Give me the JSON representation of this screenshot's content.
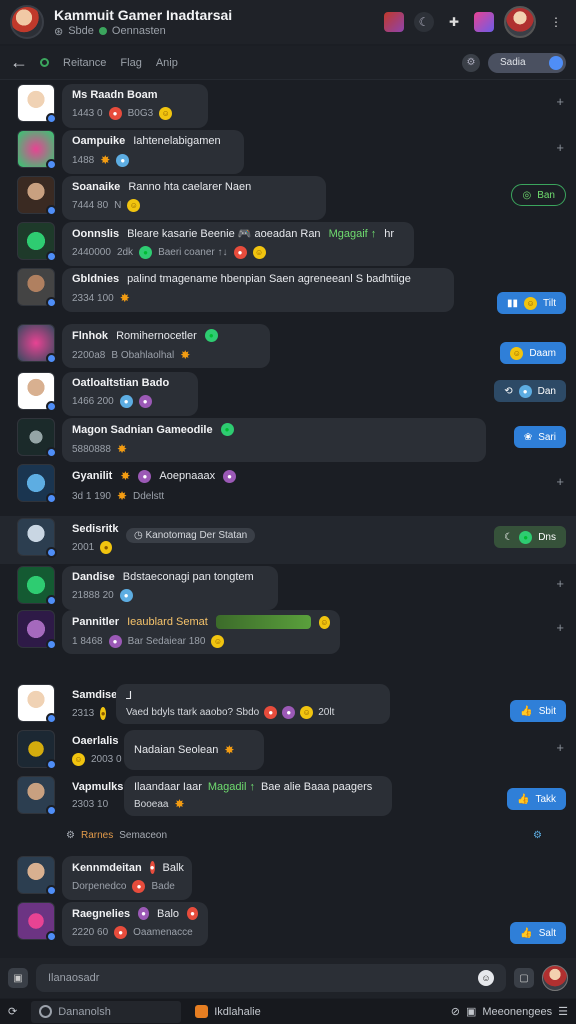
{
  "header": {
    "title": "Kammuit Gamer Inadtarsai",
    "subtitle": "Sbde",
    "status": "Oennasten"
  },
  "nav": {
    "back": "←",
    "tabs": [
      "Reitance",
      "Flag",
      "Anip"
    ],
    "toggle_label": "Sadia"
  },
  "messages": [
    {
      "name": "Ms Raadn Boam",
      "time": "1443 0",
      "meta": "B0G3",
      "react": ""
    },
    {
      "name": "Oampuike",
      "text": "Iahtenelabigamen",
      "time": "1488",
      "react": ""
    },
    {
      "name": "Soanaike",
      "text": "Ranno hta caelarer Naen",
      "time": "7444 80",
      "meta": "N",
      "react": "Ban"
    },
    {
      "name": "Oonnslis",
      "text": "Bleare kasarie Beenie 🎮 aoeadan Ran",
      "highlight": "Mgagaif ↑",
      "extra": "hr",
      "time": "2440000",
      "meta": "2dk",
      "sub": "Baeri coaner ↑↓",
      "react": ""
    },
    {
      "name": "Gbldnies",
      "text": "palind tmagename hbenpian Saen agreneeanl S badhtiige",
      "time": "2334 100",
      "react": "Tilt"
    },
    {
      "name": "Flnhok",
      "text": "Romihernocetler",
      "time": "2200a8",
      "meta": "B Obahlaolhal",
      "react": "Daam"
    },
    {
      "name": "Oatloaltstian Bado",
      "time": "1466 200",
      "react": "Dan"
    },
    {
      "name": "Magon Sadnian Gameodile",
      "time": "5880888",
      "react": "Sari"
    },
    {
      "name": "Gyanilit",
      "text": "Aoepnaaax",
      "time": "3d 1 190",
      "meta": "Ddelstt",
      "react": ""
    },
    {
      "name": "Sedisritk",
      "time": "2001",
      "pill": "Kanotomag Der Statan",
      "react": "Dns"
    },
    {
      "name": "Dandise",
      "text": "Bdstaeconagi pan tongtem",
      "time": "21888 20",
      "react": ""
    },
    {
      "name": "Pannitler",
      "highlight": "Ieaublard Semat",
      "time": "1 8468",
      "meta": "Bar Sedaiear 180",
      "react": ""
    },
    {
      "name": "Samdise",
      "text": "⅃",
      "time": "2313",
      "sub": "Vaed bdyls ttark aaobo? Sbdo",
      "meta": "20lt",
      "react": "Sbit"
    },
    {
      "name": "Oaerlalis",
      "text": "Nadaian Seolean",
      "time": "2003 0",
      "react": ""
    },
    {
      "name": "Vapmulks",
      "text": "Ilaandaar Iaar",
      "highlight": "Magadil ↑",
      "extra": "Bae alie Baaa paagers",
      "time": "2303 10",
      "meta": "Booeaa",
      "react": "Takk"
    },
    {
      "name": "Kennmdeitan",
      "text": "Balk",
      "time": "Dorpenedco",
      "meta": "Bade",
      "react": ""
    },
    {
      "name": "Raegnelies",
      "text": "Balo",
      "time": "2220 60",
      "meta": "Oaamenacce",
      "react": "Salt"
    }
  ],
  "system_line": {
    "name": "Rarnes",
    "text": "Semaceon"
  },
  "composer": {
    "placeholder": "Ilanaosadr"
  },
  "bottom": {
    "search": "Dananolsh",
    "app": "Ikdlahalie",
    "messages": "Meeonengees"
  },
  "colors": {
    "accent": "#2f7fd8",
    "online": "#3ba55d",
    "highlight": "#6fdc6f"
  }
}
